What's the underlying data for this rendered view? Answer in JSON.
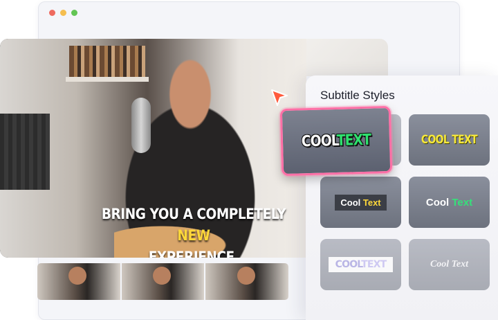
{
  "colors": {
    "dot_red": "#ee6a5f",
    "dot_yellow": "#f5be4f",
    "dot_green": "#62c554",
    "cursor": "#ff5a3c",
    "selection_border": "#ff6fa6"
  },
  "video": {
    "caption_main": "BRING YOU A COMPLETELY ",
    "caption_highlight": "NEW",
    "caption_line2": "EXPERIENCE."
  },
  "panel": {
    "title": "Subtitle Styles",
    "styles": [
      {
        "word1": "COOL",
        "word2": "TEXT"
      },
      {
        "text": "COOL TEXT"
      },
      {
        "word1": "Cool ",
        "word2": "Text"
      },
      {
        "word1": "Cool ",
        "word2": "Text"
      },
      {
        "word1": "COOL",
        "word2": "TEXT"
      },
      {
        "text": "Cool Text"
      }
    ]
  },
  "icons": {
    "cursor": "pointer-arrow-icon"
  }
}
